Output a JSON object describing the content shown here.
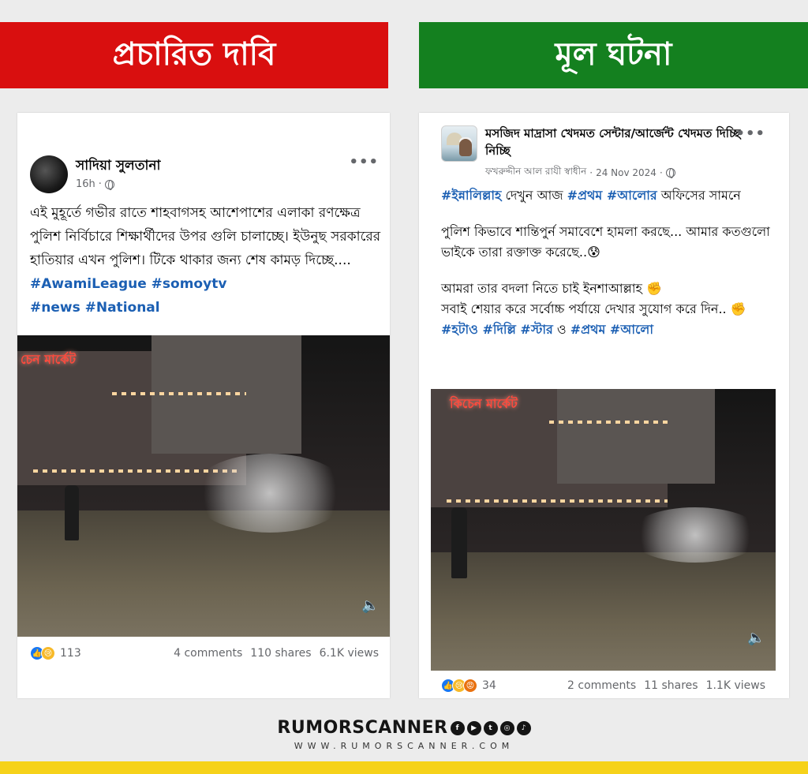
{
  "banners": {
    "left": "প্রচারিত দাবি",
    "right": "মূল ঘটনা"
  },
  "left_post": {
    "author": "সাদিয়া সুলতানা",
    "time": "16h",
    "more": "•••",
    "text": "এই মুহূর্তে গভীর রাতে শাহবাগসহ আশেপাশের এলাকা রণক্ষেত্র পুলিশ নির্বিচারে শিক্ষার্থীদের উপর গুলি চালাচ্ছে। ইউনুছ সরকারের হাতিয়ার এখন পুলিশ। টিকে থাকার জন্য শেষ কামড় দিচ্ছে....",
    "hashtags_line1": "#AwamiLeague #somoytv",
    "hashtags_line2": "#news #National",
    "video_sign": "চেন মার্কেট",
    "reaction_count": "113",
    "comments": "4 comments",
    "shares": "110 shares",
    "views": "6.1K views"
  },
  "right_post": {
    "author": "মসজিদ মাদ্রাসা খেদমত সেন্টার/আর্জেন্ট খেদমত দিচ্ছি নিচ্ছি",
    "byline": "ফখরুদ্দীন আল রাযী স্বাধীন",
    "date": "24 Nov 2024",
    "more": "•••",
    "line1_tag1": "#ইন্নালিল্লাহ",
    "line1_text1": " দেখুন আজ ",
    "line1_tag2": "#প্রথম",
    "line1_tag3": " #আলোর",
    "line1_text2": " অফিসের সামনে",
    "para2": "পুলিশ কিভাবে শান্তিপুর্ন সমাবেশে হামলা করছে... আমার কতগুলো ভাইকে তারা রক্তাক্ত করেছে..😰",
    "para3a": " আমরা তার বদলা নিতে চাই ইনশাআল্লাহ ✊",
    "para3b": "সবাই শেয়ার করে সর্বোচ্চ পর্যায়ে দেখার সুযোগ করে দিন.. ✊",
    "tags_last_1": " #হটাও #দিল্লি #স্টার",
    "tags_last_o": " ও ",
    "tags_last_2": "#প্রথম #আলো",
    "video_sign": "কিচেন মার্কেট",
    "reaction_count": "34",
    "comments": "2 comments",
    "shares": "11 shares",
    "views": "1.1K views"
  },
  "brand": {
    "name": "RUMORSCANNER",
    "url": "WWW.RUMORSCANNER.COM",
    "social_icons": [
      "facebook-icon",
      "youtube-icon",
      "twitter-icon",
      "instagram-icon",
      "tiktok-icon"
    ]
  },
  "colors": {
    "banner_red": "#d90f0f",
    "banner_green": "#14801f",
    "hashtag_blue": "#1b5fb3",
    "footer_yellow": "#f6d21a"
  }
}
